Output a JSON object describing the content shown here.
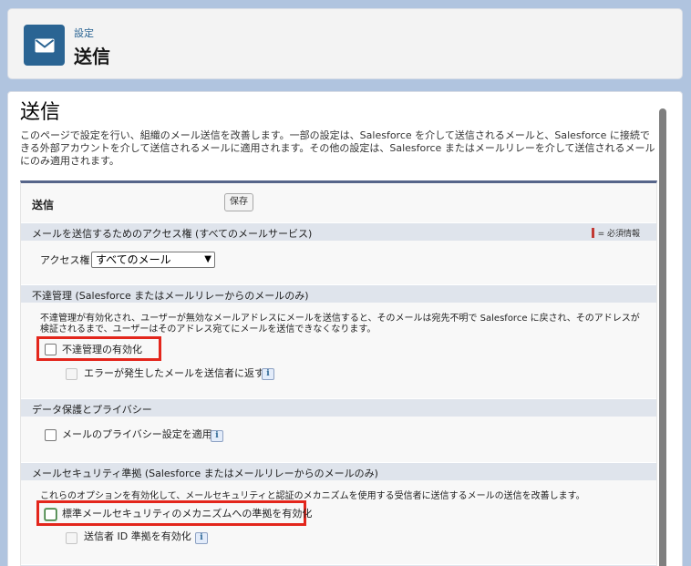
{
  "header": {
    "breadcrumb": "設定",
    "title": "送信",
    "icon": "mail-icon"
  },
  "page": {
    "title": "送信",
    "description": "このページで設定を行い、組織のメール送信を改善します。一部の設定は、Salesforce を介して送信されるメールと、Salesforce に接続できる外部アカウントを介して送信されるメールに適用されます。その他の設定は、Salesforce またはメールリレーを介して送信されるメールにのみ適用されます。"
  },
  "panel": {
    "title": "送信",
    "save_label": "保存"
  },
  "required_legend": "= 必須情報",
  "sections": {
    "access": {
      "title": "メールを送信するためのアクセス権 (すべてのメールサービス)",
      "field_label": "アクセス権",
      "selected": "すべてのメール"
    },
    "bounce": {
      "title": "不達管理 (Salesforce またはメールリレーからのメールのみ)",
      "description": "不達管理が有効化され、ユーザーが無効なメールアドレスにメールを送信すると、そのメールは宛先不明で Salesforce に戻され、そのアドレスが検証されるまで、ユーザーはそのアドレス宛てにメールを送信できなくなります。",
      "enable_label": "不達管理の有効化",
      "return_label": "エラーが発生したメールを送信者に返す"
    },
    "privacy": {
      "title": "データ保護とプライバシー",
      "apply_label": "メールのプライバシー設定を適用"
    },
    "security": {
      "title": "メールセキュリティ準拠 (Salesforce またはメールリレーからのメールのみ)",
      "description": "これらのオプションを有効化して、メールセキュリティと認証のメカニズムを使用する受信者に送信するメールの送信を改善します。",
      "standard_label": "標準メールセキュリティのメカニズムへの準拠を有効化",
      "sender_id_label": "送信者 ID 準拠を有効化"
    }
  },
  "info_glyph": "i",
  "select_arrow": "▼",
  "colors": {
    "accent": "#2a6493",
    "highlight": "#e3261c",
    "required": "#c23934",
    "background": "#b0c4df"
  }
}
